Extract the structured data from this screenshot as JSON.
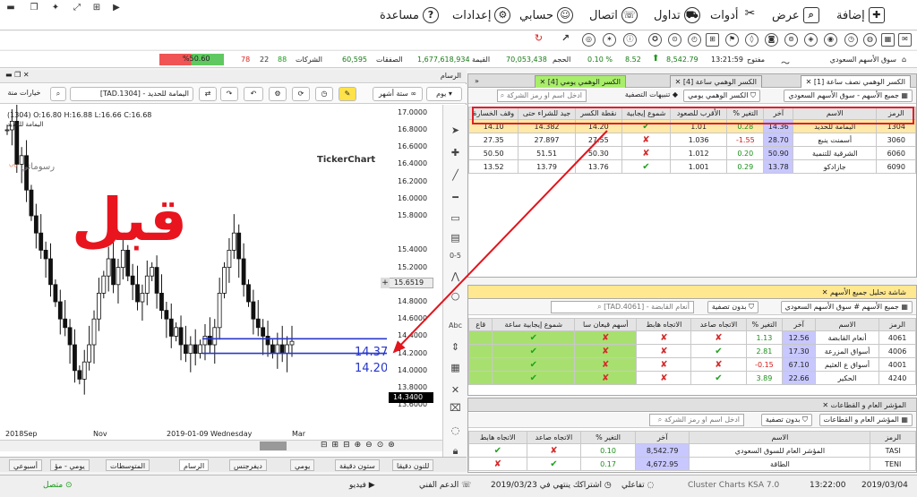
{
  "menu": {
    "items": [
      "إضافة",
      "عرض",
      "أدوات",
      "تداول",
      "اتصال",
      "حسابي",
      "إعدادات",
      "مساعدة"
    ]
  },
  "ticker": {
    "market": "سوق الأسهم السعودي",
    "state": "مفتوح",
    "time": "13:21:59",
    "index_value": "8,542.79",
    "index_change": "8.52",
    "index_pct": "0.10 %",
    "volume_label": "الحجم",
    "volume": "70,053,438",
    "value_label": "القيمة",
    "value": "1,677,618,934",
    "trades_label": "الصفقات",
    "trades": "60,595",
    "companies_label": "الشركات",
    "up": "88",
    "unch": "22",
    "down": "78",
    "ratio": "%50.60"
  },
  "chart": {
    "header": "الرسام",
    "symbol_box": "اليمامة للحديد - [TAD.1304]",
    "info_line": "(1304) O:16.80 H:16.88 L:16.66 C:16.68",
    "info_name": "اليمامة للحديد",
    "period_label": "يوم",
    "range_label": "ستة أشهر",
    "options_label": "خيارات منة",
    "drawings_label": "رسوماتي",
    "brand": "TickerChart",
    "overlay_text": "قبل",
    "line_high_label": "14.37",
    "line_low_label": "14.20",
    "current_price_tag": "14.3400",
    "crosshair_price": "15.6519",
    "yticks": [
      "17.0000",
      "16.8000",
      "16.6000",
      "16.4000",
      "16.2000",
      "16.0000",
      "15.8000",
      "15.4000",
      "15.2000",
      "15.0000",
      "14.8000",
      "14.6000",
      "14.4000",
      "14.2000",
      "14.0000",
      "13.8000",
      "13.6000"
    ],
    "xticks": [
      "2018Sep",
      "Nov",
      "2019-01-09 Wednesday",
      "Mar"
    ],
    "tabs": [
      "أسبوعي",
      "يومي - مؤ",
      "المتوسطات",
      "الرسام",
      "ديفرجنس",
      "يومي",
      "ستون دقيقة",
      "للنون دقيقا"
    ]
  },
  "chart_data": {
    "type": "candlestick",
    "title": "",
    "xlabel": "",
    "ylabel": "",
    "ylim": [
      13.55,
      17.05
    ],
    "xticks": [
      "2018Sep",
      "Nov",
      "2019-01-09 Wednesday",
      "Mar"
    ],
    "series": [
      {
        "name": "اليمامة للحديد",
        "values": [
          16.8,
          16.9,
          16.4,
          16.5,
          16.1,
          15.8,
          15.6,
          15.4,
          15.3,
          15.0,
          14.8,
          14.6,
          14.5,
          14.3,
          14.0,
          13.9,
          14.1,
          14.3,
          14.6,
          14.9,
          15.1,
          15.3,
          15.0,
          15.2,
          15.4,
          15.1,
          15.0,
          14.8,
          14.9,
          15.1,
          15.2,
          14.9,
          14.7,
          14.6,
          14.4,
          14.5,
          14.3,
          14.2,
          14.3,
          14.2,
          14.3,
          14.4,
          14.3,
          14.5,
          14.9,
          15.2,
          15.4,
          15.6,
          15.3,
          15.0,
          14.8,
          14.6,
          14.5,
          14.4,
          14.3,
          14.2,
          14.3,
          14.2,
          14.3,
          14.34
        ]
      }
    ],
    "lines": [
      {
        "label": "14.37",
        "y": 14.37
      },
      {
        "label": "14.20",
        "y": 14.2
      }
    ]
  },
  "panel1": {
    "tabs": [
      "الكسر الوهمي نصف ساعة [1]",
      "الكسر الوهمي ساعة [4]",
      "الكسر الوهمي يومي [4]"
    ],
    "market_btn": "جميع الأسهم - سوق الأسهم السعودي",
    "filter_btn": "الكسر الوهمي يومي",
    "alerts_btn": "تنبيهات التصفية",
    "search_placeholder": "ادخل اسم او رمز الشركة",
    "columns": [
      "الرمز",
      "الاسم",
      "آخر",
      "التغير %",
      "الأقرب للصعود",
      "شموع إيجابية",
      "نقطة الكسر",
      "جيد للشراء حتى",
      "وقف الخسارة"
    ],
    "rows": [
      {
        "code": "1304",
        "name": "اليمامة للحديد",
        "last": "14.36",
        "chg": "0.28",
        "near": "1.01",
        "pos": "check",
        "brk": "14.20",
        "good": "14.382",
        "stop": "14.10"
      },
      {
        "code": "3060",
        "name": "أسمنت ينبع",
        "last": "28.70",
        "chg": "1.55-",
        "near": "1.036",
        "pos": "cross",
        "brk": "27.55",
        "good": "27.897",
        "stop": "27.35"
      },
      {
        "code": "6060",
        "name": "الشرقية للتنمية",
        "last": "50.90",
        "chg": "0.20",
        "near": "1.012",
        "pos": "cross",
        "brk": "50.30",
        "good": "51.51",
        "stop": "50.50"
      },
      {
        "code": "6090",
        "name": "جازادكو",
        "last": "13.78",
        "chg": "0.29",
        "near": "1.001",
        "pos": "check",
        "brk": "13.76",
        "good": "13.79",
        "stop": "13.52"
      }
    ]
  },
  "panel2": {
    "title": "شاشة تحليل جميع الأسهم",
    "market_btn": "جميع الأسهم # سوق الأسهم السعودي",
    "filter_btn": "بدون تصفية",
    "search_value": "أنعام القابضة - [TAD.4061]",
    "columns": [
      "الرمز",
      "الاسم",
      "آخر",
      "التغير %",
      "الاتجاه صاعد",
      "الاتجاه هابط",
      "أسهم قيعان سا",
      "شموع إيجابية ساعة",
      "قاع"
    ],
    "rows": [
      {
        "code": "4061",
        "name": "أنعام القابضة",
        "last": "12.56",
        "chg": "1.13",
        "up": "cross",
        "down": "cross",
        "q": "cross",
        "c": "check"
      },
      {
        "code": "4006",
        "name": "أسواق المزرعة",
        "last": "17.30",
        "chg": "2.81",
        "up": "check",
        "down": "cross",
        "q": "cross",
        "c": "check"
      },
      {
        "code": "4001",
        "name": "أسواق ع العثيم",
        "last": "67.10",
        "chg": "0.15-",
        "up": "cross",
        "down": "cross",
        "q": "cross",
        "c": "check"
      },
      {
        "code": "4240",
        "name": "الحكير",
        "last": "22.66",
        "chg": "3.89",
        "up": "check",
        "down": "cross",
        "q": "cross",
        "c": "check"
      }
    ]
  },
  "panel3": {
    "title": "المؤشر العام و القطاعات",
    "market_btn": "المؤشر العام و القطاعات",
    "filter_btn": "بدون تصفية",
    "search_placeholder": "ادخل اسم او رمز الشركة",
    "columns": [
      "الرمز",
      "الاسم",
      "آخر",
      "التغير %",
      "الاتجاه صاعد",
      "الاتجاه هابط"
    ],
    "rows": [
      {
        "code": "TASI",
        "name": "المؤشر العام للسوق السعودي",
        "last": "8,542.79",
        "chg": "0.10",
        "up": "cross",
        "down": "check"
      },
      {
        "code": "TENI",
        "name": "الطاقة",
        "last": "4,672.95",
        "chg": "0.17",
        "up": "check",
        "down": "cross"
      }
    ]
  },
  "status": {
    "date": "2019/03/04",
    "time": "13:22:00",
    "app": "Cluster Charts KSA 7.0",
    "interactive": "تفاعلي",
    "subscription": "اشتراكك ينتهي في 2019/03/23",
    "support": "الدعم الفني",
    "video": "فيديو",
    "connected": "متصل"
  }
}
